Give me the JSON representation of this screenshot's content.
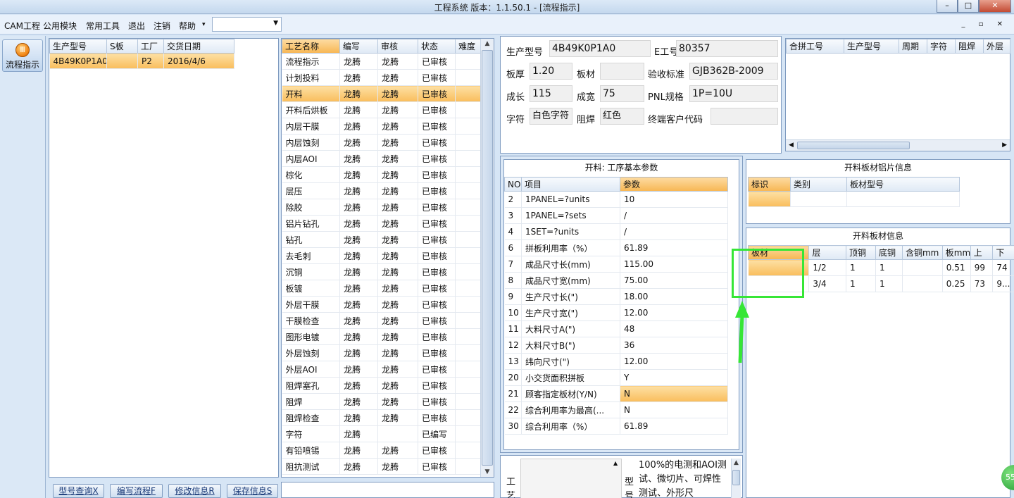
{
  "window": {
    "title": "工程系统   版本：1.1.50.1 - [流程指示]"
  },
  "menu": {
    "items": [
      "CAM工程",
      "公用模块",
      "常用工具",
      "退出",
      "注销",
      "帮助"
    ],
    "help_arrow": "▾",
    "combo_value": ""
  },
  "nav": {
    "button_label": "流程指示"
  },
  "orders": {
    "headers": [
      "生产型号",
      "S板",
      "工厂",
      "交货日期"
    ],
    "rows": [
      [
        "4B49K0P1A0",
        "",
        "P2",
        "2016/4/6"
      ]
    ]
  },
  "process": {
    "headers": [
      "工艺名称",
      "编写",
      "审核",
      "状态",
      "难度"
    ],
    "selected_index": 2,
    "rows": [
      [
        "流程指示",
        "龙腾",
        "龙腾",
        "已审核",
        ""
      ],
      [
        "计划投料",
        "龙腾",
        "龙腾",
        "已审核",
        ""
      ],
      [
        "开料",
        "龙腾",
        "龙腾",
        "已审核",
        ""
      ],
      [
        "开料后烘板",
        "龙腾",
        "龙腾",
        "已审核",
        ""
      ],
      [
        "内层干膜",
        "龙腾",
        "龙腾",
        "已审核",
        ""
      ],
      [
        "内层蚀刻",
        "龙腾",
        "龙腾",
        "已审核",
        ""
      ],
      [
        "内层AOI",
        "龙腾",
        "龙腾",
        "已审核",
        ""
      ],
      [
        "棕化",
        "龙腾",
        "龙腾",
        "已审核",
        ""
      ],
      [
        "层压",
        "龙腾",
        "龙腾",
        "已审核",
        ""
      ],
      [
        "除胶",
        "龙腾",
        "龙腾",
        "已审核",
        ""
      ],
      [
        "铝片钻孔",
        "龙腾",
        "龙腾",
        "已审核",
        ""
      ],
      [
        "钻孔",
        "龙腾",
        "龙腾",
        "已审核",
        ""
      ],
      [
        "去毛刺",
        "龙腾",
        "龙腾",
        "已审核",
        ""
      ],
      [
        "沉铜",
        "龙腾",
        "龙腾",
        "已审核",
        ""
      ],
      [
        "板镀",
        "龙腾",
        "龙腾",
        "已审核",
        ""
      ],
      [
        "外层干膜",
        "龙腾",
        "龙腾",
        "已审核",
        ""
      ],
      [
        "干膜检查",
        "龙腾",
        "龙腾",
        "已审核",
        ""
      ],
      [
        "图形电镀",
        "龙腾",
        "龙腾",
        "已审核",
        ""
      ],
      [
        "外层蚀刻",
        "龙腾",
        "龙腾",
        "已审核",
        ""
      ],
      [
        "外层AOI",
        "龙腾",
        "龙腾",
        "已审核",
        ""
      ],
      [
        "阻焊塞孔",
        "龙腾",
        "龙腾",
        "已审核",
        ""
      ],
      [
        "阻焊",
        "龙腾",
        "龙腾",
        "已审核",
        ""
      ],
      [
        "阻焊检查",
        "龙腾",
        "龙腾",
        "已审核",
        ""
      ],
      [
        "字符",
        "龙腾",
        "",
        "已编写",
        ""
      ],
      [
        "有铅喷锡",
        "龙腾",
        "龙腾",
        "已审核",
        ""
      ],
      [
        "阻抗测试",
        "龙腾",
        "龙腾",
        "已审核",
        ""
      ]
    ]
  },
  "buttons": {
    "query": "型号查询X",
    "edit_flow": "编写流程F",
    "modify": "修改信息R",
    "save": "保存信息S"
  },
  "info": {
    "model_label": "生产型号",
    "model_value": "4B49K0P1A0",
    "eno_label": "E工号",
    "eno_value": "80357",
    "thickness_label": "板厚",
    "thickness_value": "1.20",
    "material_label": "板材",
    "material_value": "",
    "standard_label": "验收标准",
    "standard_value": "GJB362B-2009",
    "length_label": "成长",
    "length_value": "115",
    "width_label": "成宽",
    "width_value": "75",
    "pnl_label": "PNL规格",
    "pnl_value": "1P=10U",
    "char_label": "字符",
    "char_value": "白色字符",
    "mask_label": "阻焊",
    "mask_value": "红色",
    "customer_label": "终端客户代码",
    "customer_value": ""
  },
  "merge": {
    "headers": [
      "合拼工号",
      "生产型号",
      "周期",
      "字符",
      "阻焊",
      "外层"
    ]
  },
  "params": {
    "title": "开料: 工序基本参数",
    "headers": [
      "NO",
      "项目",
      "参数"
    ],
    "selected_index": 12,
    "rows": [
      [
        "2",
        "1PANEL=?units",
        "10"
      ],
      [
        "3",
        "1PANEL=?sets",
        "/"
      ],
      [
        "4",
        "1SET=?units",
        "/"
      ],
      [
        "6",
        "拼板利用率（%）",
        "61.89"
      ],
      [
        "7",
        "成品尺寸长(mm)",
        "115.00"
      ],
      [
        "8",
        "成品尺寸宽(mm)",
        "75.00"
      ],
      [
        "9",
        "生产尺寸长(\")",
        "18.00"
      ],
      [
        "10",
        "生产尺寸宽(\")",
        "12.00"
      ],
      [
        "11",
        "大料尺寸A(\")",
        "48"
      ],
      [
        "12",
        "大料尺寸B(\")",
        "36"
      ],
      [
        "13",
        "纬向尺寸(\")",
        "12.00"
      ],
      [
        "20",
        "小交货面积拼板",
        "Y"
      ],
      [
        "21",
        "顾客指定板材(Y/N)",
        "N"
      ],
      [
        "22",
        "综合利用率为最高(...",
        "N"
      ],
      [
        "30",
        "综合利用率（%）",
        "61.89"
      ]
    ]
  },
  "alu": {
    "title": "开料板材铝片信息",
    "headers": [
      "标识",
      "类别",
      "板材型号"
    ]
  },
  "board": {
    "title": "开料板材信息",
    "headers": [
      "板材",
      "层",
      "顶铜",
      "底铜",
      "含铜mm",
      "板mm",
      "上",
      "下"
    ],
    "rows": [
      [
        "",
        "1/2",
        "1",
        "1",
        "",
        "0.51",
        "99",
        "74"
      ],
      [
        "",
        "3/4",
        "1",
        "1",
        "",
        "0.25",
        "73",
        "9..."
      ]
    ]
  },
  "bottom": {
    "left_label": "工艺",
    "right_label": "型号",
    "note": "100%的电测和AOI测试、微切片、可焊性测试、外形尺"
  },
  "badge": {
    "text": "55"
  }
}
